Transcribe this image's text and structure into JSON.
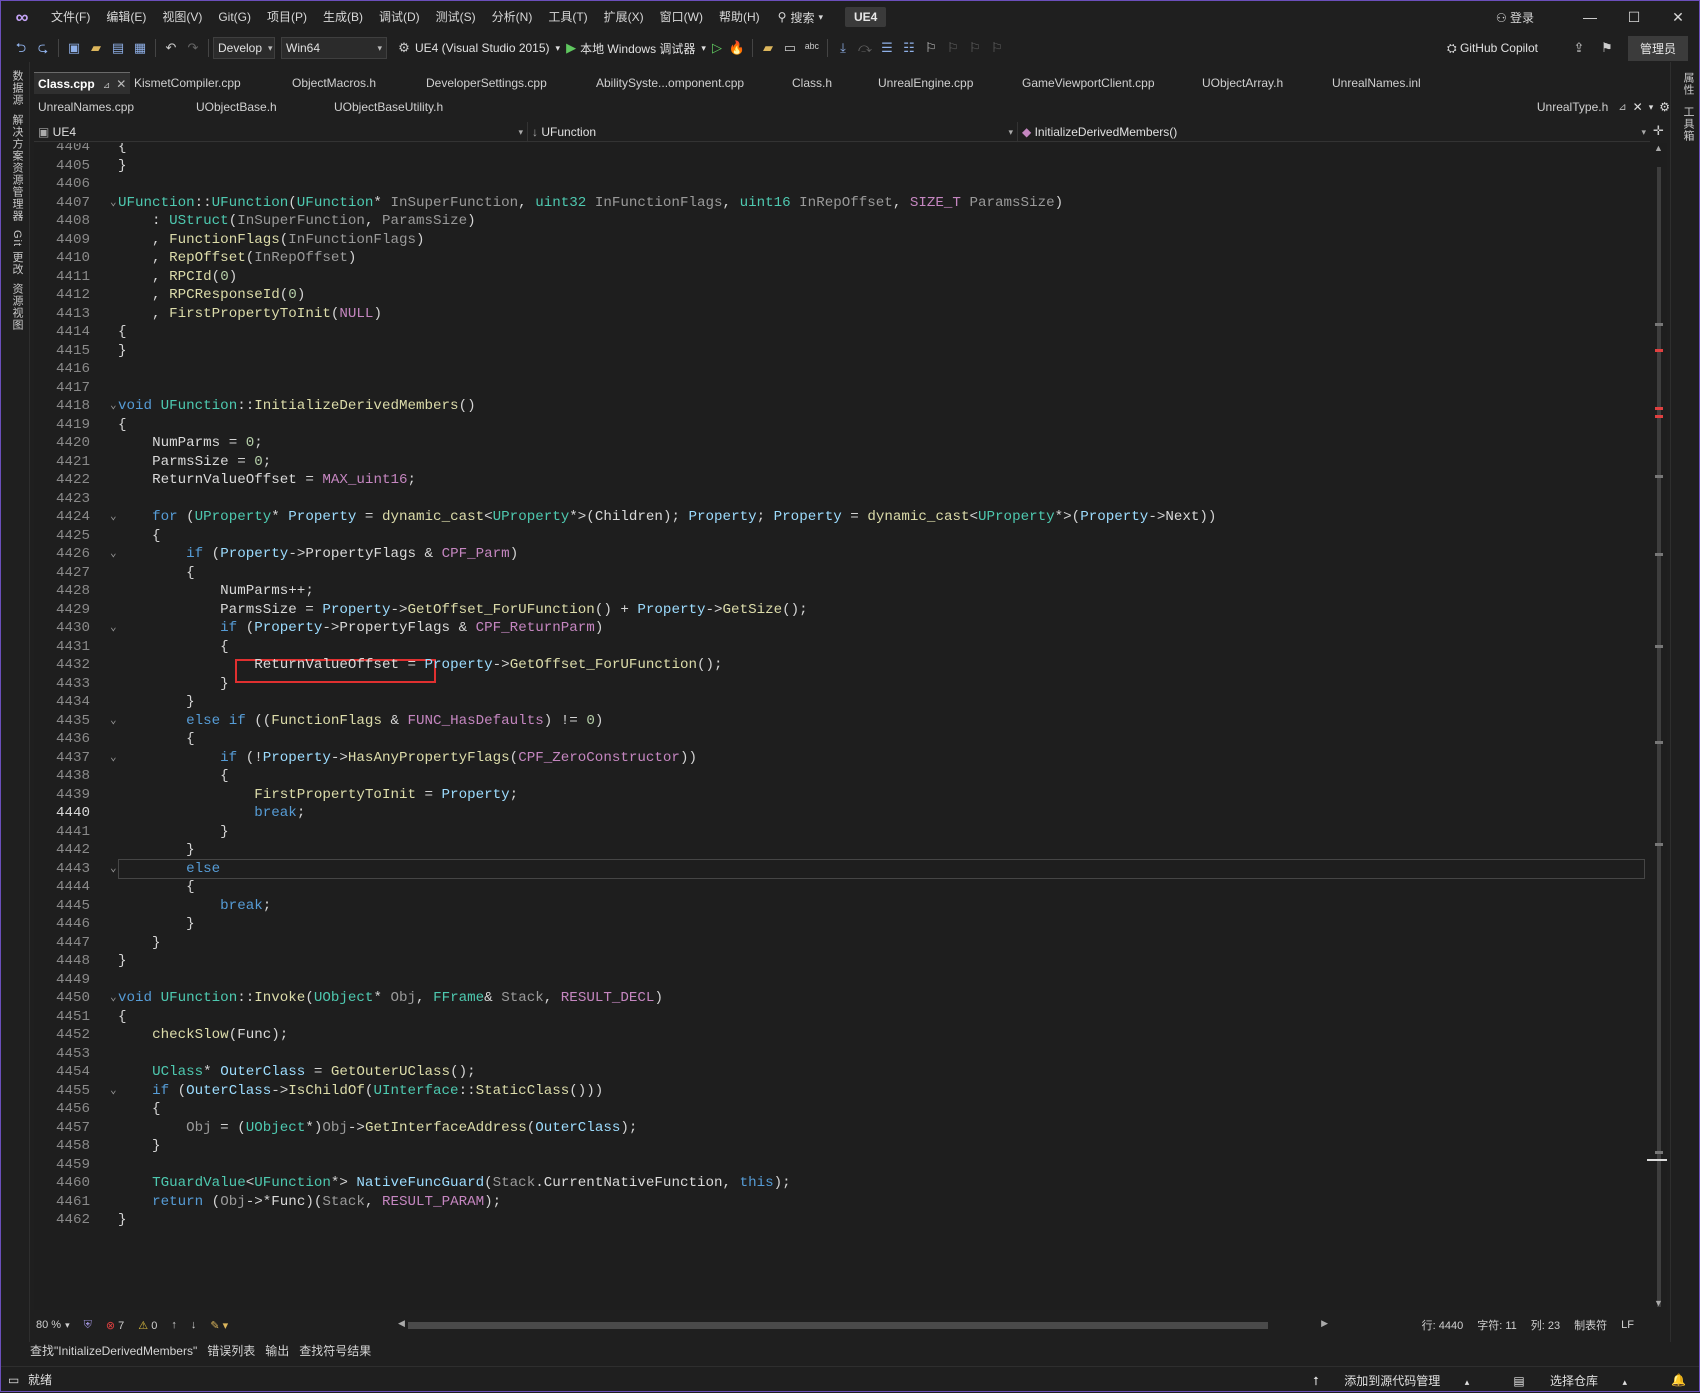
{
  "titlebar": {
    "menus": [
      "文件(F)",
      "编辑(E)",
      "视图(V)",
      "Git(G)",
      "项目(P)",
      "生成(B)",
      "调试(D)",
      "测试(S)",
      "分析(N)",
      "工具(T)",
      "扩展(X)",
      "窗口(W)",
      "帮助(H)"
    ],
    "search_label": "搜索",
    "solution_badge": "UE4",
    "login_label": "登录"
  },
  "toolbar": {
    "config": "Develop",
    "platform": "Win64",
    "startup_project": "UE4 (Visual Studio 2015)",
    "run_label": "本地 Windows 调试器",
    "copilot_label": "GitHub Copilot",
    "admin_label": "管理员"
  },
  "left_rail": [
    "数据源",
    "解决方案资源管理器",
    "Git 更改",
    "资源视图"
  ],
  "right_rail": [
    "属性",
    "工具箱"
  ],
  "tabs_row1": [
    {
      "label": "Class.cpp",
      "active": true
    },
    {
      "label": "KismetCompiler.cpp"
    },
    {
      "label": "ObjectMacros.h"
    },
    {
      "label": "DeveloperSettings.cpp"
    },
    {
      "label": "AbilitySyste...omponent.cpp"
    },
    {
      "label": "Class.h"
    },
    {
      "label": "UnrealEngine.cpp"
    },
    {
      "label": "GameViewportClient.cpp"
    },
    {
      "label": "UObjectArray.h"
    },
    {
      "label": "UnrealNames.inl"
    }
  ],
  "tabs_row2": [
    {
      "label": "UnrealNames.cpp"
    },
    {
      "label": "UObjectBase.h"
    },
    {
      "label": "UObjectBaseUtility.h"
    }
  ],
  "tabs_row2_right": "UnrealType.h",
  "navbar": {
    "project": "UE4",
    "scope": "UFunction",
    "member": "InitializeDerivedMembers()"
  },
  "editor": {
    "current_line": "4440",
    "lines": [
      {
        "n": "4404",
        "t": "{"
      },
      {
        "n": "4405",
        "t": "}"
      },
      {
        "n": "4406",
        "t": ""
      },
      {
        "n": "4407",
        "t": "UFunction::UFunction(UFunction* InSuperFunction, uint32 InFunctionFlags, uint16 InRepOffset, SIZE_T ParamsSize)"
      },
      {
        "n": "4408",
        "t": "    : UStruct(InSuperFunction, ParamsSize)"
      },
      {
        "n": "4409",
        "t": "    , FunctionFlags(InFunctionFlags)"
      },
      {
        "n": "4410",
        "t": "    , RepOffset(InRepOffset)"
      },
      {
        "n": "4411",
        "t": "    , RPCId(0)"
      },
      {
        "n": "4412",
        "t": "    , RPCResponseId(0)"
      },
      {
        "n": "4413",
        "t": "    , FirstPropertyToInit(NULL)"
      },
      {
        "n": "4414",
        "t": "{"
      },
      {
        "n": "4415",
        "t": "}"
      },
      {
        "n": "4416",
        "t": ""
      },
      {
        "n": "4417",
        "t": ""
      },
      {
        "n": "4418",
        "t": "void UFunction::InitializeDerivedMembers()"
      },
      {
        "n": "4419",
        "t": "{"
      },
      {
        "n": "4420",
        "t": "    NumParms = 0;"
      },
      {
        "n": "4421",
        "t": "    ParmsSize = 0;"
      },
      {
        "n": "4422",
        "t": "    ReturnValueOffset = MAX_uint16;"
      },
      {
        "n": "4423",
        "t": ""
      },
      {
        "n": "4424",
        "t": "    for (UProperty* Property = dynamic_cast<UProperty*>(Children); Property; Property = dynamic_cast<UProperty*>(Property->Next))"
      },
      {
        "n": "4425",
        "t": "    {"
      },
      {
        "n": "4426",
        "t": "        if (Property->PropertyFlags & CPF_Parm)"
      },
      {
        "n": "4427",
        "t": "        {"
      },
      {
        "n": "4428",
        "t": "            NumParms++;"
      },
      {
        "n": "4429",
        "t": "            ParmsSize = Property->GetOffset_ForUFunction() + Property->GetSize();"
      },
      {
        "n": "4430",
        "t": "            if (Property->PropertyFlags & CPF_ReturnParm)"
      },
      {
        "n": "4431",
        "t": "            {"
      },
      {
        "n": "4432",
        "t": "                ReturnValueOffset = Property->GetOffset_ForUFunction();"
      },
      {
        "n": "4433",
        "t": "            }"
      },
      {
        "n": "4434",
        "t": "        }"
      },
      {
        "n": "4435",
        "t": "        else if ((FunctionFlags & FUNC_HasDefaults) != 0)"
      },
      {
        "n": "4436",
        "t": "        {"
      },
      {
        "n": "4437",
        "t": "            if (!Property->HasAnyPropertyFlags(CPF_ZeroConstructor))"
      },
      {
        "n": "4438",
        "t": "            {"
      },
      {
        "n": "4439",
        "t": "                FirstPropertyToInit = Property;"
      },
      {
        "n": "4440",
        "t": "                break;"
      },
      {
        "n": "4441",
        "t": "            }"
      },
      {
        "n": "4442",
        "t": "        }"
      },
      {
        "n": "4443",
        "t": "        else"
      },
      {
        "n": "4444",
        "t": "        {"
      },
      {
        "n": "4445",
        "t": "            break;"
      },
      {
        "n": "4446",
        "t": "        }"
      },
      {
        "n": "4447",
        "t": "    }"
      },
      {
        "n": "4448",
        "t": "}"
      },
      {
        "n": "4449",
        "t": ""
      },
      {
        "n": "4450",
        "t": "void UFunction::Invoke(UObject* Obj, FFrame& Stack, RESULT_DECL)"
      },
      {
        "n": "4451",
        "t": "{"
      },
      {
        "n": "4452",
        "t": "    checkSlow(Func);"
      },
      {
        "n": "4453",
        "t": ""
      },
      {
        "n": "4454",
        "t": "    UClass* OuterClass = GetOuterUClass();"
      },
      {
        "n": "4455",
        "t": "    if (OuterClass->IsChildOf(UInterface::StaticClass()))"
      },
      {
        "n": "4456",
        "t": "    {"
      },
      {
        "n": "4457",
        "t": "        Obj = (UObject*)Obj->GetInterfaceAddress(OuterClass);"
      },
      {
        "n": "4458",
        "t": "    }"
      },
      {
        "n": "4459",
        "t": ""
      },
      {
        "n": "4460",
        "t": "    TGuardValue<UFunction*> NativeFuncGuard(Stack.CurrentNativeFunction, this);"
      },
      {
        "n": "4461",
        "t": "    return (Obj->*Func)(Stack, RESULT_PARAM);"
      },
      {
        "n": "4462",
        "t": "}"
      }
    ]
  },
  "status": {
    "zoom": "80 %",
    "errors": "7",
    "warnings": "0",
    "line": "行: 4440",
    "char": "字符: 11",
    "col": "列: 23",
    "tabs": "制表符",
    "eol": "LF"
  },
  "pane_tabs": [
    "查找\"InitializeDerivedMembers\"",
    "错误列表",
    "输出",
    "查找符号结果"
  ],
  "bottom": {
    "ready": "就绪",
    "source_control": "添加到源代码管理",
    "repo": "选择仓库"
  },
  "colors": {
    "accent": "#6b4fbb",
    "highlight_box": "#e03030"
  }
}
